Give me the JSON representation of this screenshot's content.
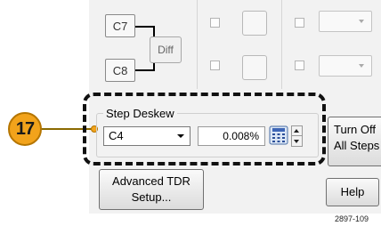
{
  "channels": {
    "c7": "C7",
    "c8": "C8",
    "diff": "Diff"
  },
  "callout": {
    "number": "17"
  },
  "step_deskew": {
    "title": "Step Deskew",
    "channel_selected": "C4",
    "value": "0.008%"
  },
  "buttons": {
    "turn_off_line1": "Turn Off",
    "turn_off_line2": "All Steps",
    "advanced_line1": "Advanced TDR",
    "advanced_line2": "Setup...",
    "help": "Help"
  },
  "figure_id": "2897-109",
  "icons": {
    "calculator": "calculator-icon",
    "spinner": "spinner-icon",
    "dropdown_arrow": "chevron-down-icon"
  },
  "colors": {
    "callout_orange": "#f2a31b",
    "panel_bg": "#f2f2f2"
  }
}
